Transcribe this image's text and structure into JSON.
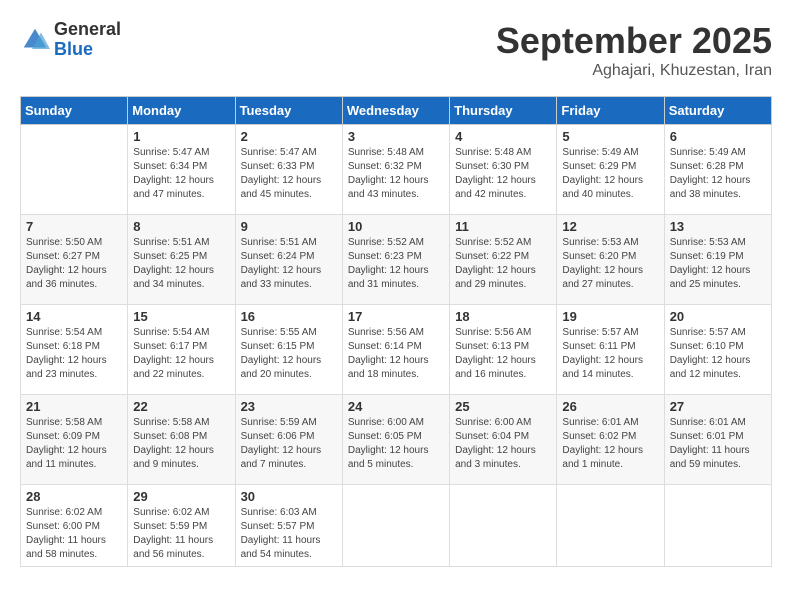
{
  "header": {
    "logo": {
      "general": "General",
      "blue": "Blue"
    },
    "title": "September 2025",
    "location": "Aghajari, Khuzestan, Iran"
  },
  "days_of_week": [
    "Sunday",
    "Monday",
    "Tuesday",
    "Wednesday",
    "Thursday",
    "Friday",
    "Saturday"
  ],
  "weeks": [
    [
      {
        "num": "",
        "sunrise": "",
        "sunset": "",
        "daylight": ""
      },
      {
        "num": "1",
        "sunrise": "Sunrise: 5:47 AM",
        "sunset": "Sunset: 6:34 PM",
        "daylight": "Daylight: 12 hours and 47 minutes."
      },
      {
        "num": "2",
        "sunrise": "Sunrise: 5:47 AM",
        "sunset": "Sunset: 6:33 PM",
        "daylight": "Daylight: 12 hours and 45 minutes."
      },
      {
        "num": "3",
        "sunrise": "Sunrise: 5:48 AM",
        "sunset": "Sunset: 6:32 PM",
        "daylight": "Daylight: 12 hours and 43 minutes."
      },
      {
        "num": "4",
        "sunrise": "Sunrise: 5:48 AM",
        "sunset": "Sunset: 6:30 PM",
        "daylight": "Daylight: 12 hours and 42 minutes."
      },
      {
        "num": "5",
        "sunrise": "Sunrise: 5:49 AM",
        "sunset": "Sunset: 6:29 PM",
        "daylight": "Daylight: 12 hours and 40 minutes."
      },
      {
        "num": "6",
        "sunrise": "Sunrise: 5:49 AM",
        "sunset": "Sunset: 6:28 PM",
        "daylight": "Daylight: 12 hours and 38 minutes."
      }
    ],
    [
      {
        "num": "7",
        "sunrise": "Sunrise: 5:50 AM",
        "sunset": "Sunset: 6:27 PM",
        "daylight": "Daylight: 12 hours and 36 minutes."
      },
      {
        "num": "8",
        "sunrise": "Sunrise: 5:51 AM",
        "sunset": "Sunset: 6:25 PM",
        "daylight": "Daylight: 12 hours and 34 minutes."
      },
      {
        "num": "9",
        "sunrise": "Sunrise: 5:51 AM",
        "sunset": "Sunset: 6:24 PM",
        "daylight": "Daylight: 12 hours and 33 minutes."
      },
      {
        "num": "10",
        "sunrise": "Sunrise: 5:52 AM",
        "sunset": "Sunset: 6:23 PM",
        "daylight": "Daylight: 12 hours and 31 minutes."
      },
      {
        "num": "11",
        "sunrise": "Sunrise: 5:52 AM",
        "sunset": "Sunset: 6:22 PM",
        "daylight": "Daylight: 12 hours and 29 minutes."
      },
      {
        "num": "12",
        "sunrise": "Sunrise: 5:53 AM",
        "sunset": "Sunset: 6:20 PM",
        "daylight": "Daylight: 12 hours and 27 minutes."
      },
      {
        "num": "13",
        "sunrise": "Sunrise: 5:53 AM",
        "sunset": "Sunset: 6:19 PM",
        "daylight": "Daylight: 12 hours and 25 minutes."
      }
    ],
    [
      {
        "num": "14",
        "sunrise": "Sunrise: 5:54 AM",
        "sunset": "Sunset: 6:18 PM",
        "daylight": "Daylight: 12 hours and 23 minutes."
      },
      {
        "num": "15",
        "sunrise": "Sunrise: 5:54 AM",
        "sunset": "Sunset: 6:17 PM",
        "daylight": "Daylight: 12 hours and 22 minutes."
      },
      {
        "num": "16",
        "sunrise": "Sunrise: 5:55 AM",
        "sunset": "Sunset: 6:15 PM",
        "daylight": "Daylight: 12 hours and 20 minutes."
      },
      {
        "num": "17",
        "sunrise": "Sunrise: 5:56 AM",
        "sunset": "Sunset: 6:14 PM",
        "daylight": "Daylight: 12 hours and 18 minutes."
      },
      {
        "num": "18",
        "sunrise": "Sunrise: 5:56 AM",
        "sunset": "Sunset: 6:13 PM",
        "daylight": "Daylight: 12 hours and 16 minutes."
      },
      {
        "num": "19",
        "sunrise": "Sunrise: 5:57 AM",
        "sunset": "Sunset: 6:11 PM",
        "daylight": "Daylight: 12 hours and 14 minutes."
      },
      {
        "num": "20",
        "sunrise": "Sunrise: 5:57 AM",
        "sunset": "Sunset: 6:10 PM",
        "daylight": "Daylight: 12 hours and 12 minutes."
      }
    ],
    [
      {
        "num": "21",
        "sunrise": "Sunrise: 5:58 AM",
        "sunset": "Sunset: 6:09 PM",
        "daylight": "Daylight: 12 hours and 11 minutes."
      },
      {
        "num": "22",
        "sunrise": "Sunrise: 5:58 AM",
        "sunset": "Sunset: 6:08 PM",
        "daylight": "Daylight: 12 hours and 9 minutes."
      },
      {
        "num": "23",
        "sunrise": "Sunrise: 5:59 AM",
        "sunset": "Sunset: 6:06 PM",
        "daylight": "Daylight: 12 hours and 7 minutes."
      },
      {
        "num": "24",
        "sunrise": "Sunrise: 6:00 AM",
        "sunset": "Sunset: 6:05 PM",
        "daylight": "Daylight: 12 hours and 5 minutes."
      },
      {
        "num": "25",
        "sunrise": "Sunrise: 6:00 AM",
        "sunset": "Sunset: 6:04 PM",
        "daylight": "Daylight: 12 hours and 3 minutes."
      },
      {
        "num": "26",
        "sunrise": "Sunrise: 6:01 AM",
        "sunset": "Sunset: 6:02 PM",
        "daylight": "Daylight: 12 hours and 1 minute."
      },
      {
        "num": "27",
        "sunrise": "Sunrise: 6:01 AM",
        "sunset": "Sunset: 6:01 PM",
        "daylight": "Daylight: 11 hours and 59 minutes."
      }
    ],
    [
      {
        "num": "28",
        "sunrise": "Sunrise: 6:02 AM",
        "sunset": "Sunset: 6:00 PM",
        "daylight": "Daylight: 11 hours and 58 minutes."
      },
      {
        "num": "29",
        "sunrise": "Sunrise: 6:02 AM",
        "sunset": "Sunset: 5:59 PM",
        "daylight": "Daylight: 11 hours and 56 minutes."
      },
      {
        "num": "30",
        "sunrise": "Sunrise: 6:03 AM",
        "sunset": "Sunset: 5:57 PM",
        "daylight": "Daylight: 11 hours and 54 minutes."
      },
      {
        "num": "",
        "sunrise": "",
        "sunset": "",
        "daylight": ""
      },
      {
        "num": "",
        "sunrise": "",
        "sunset": "",
        "daylight": ""
      },
      {
        "num": "",
        "sunrise": "",
        "sunset": "",
        "daylight": ""
      },
      {
        "num": "",
        "sunrise": "",
        "sunset": "",
        "daylight": ""
      }
    ]
  ]
}
